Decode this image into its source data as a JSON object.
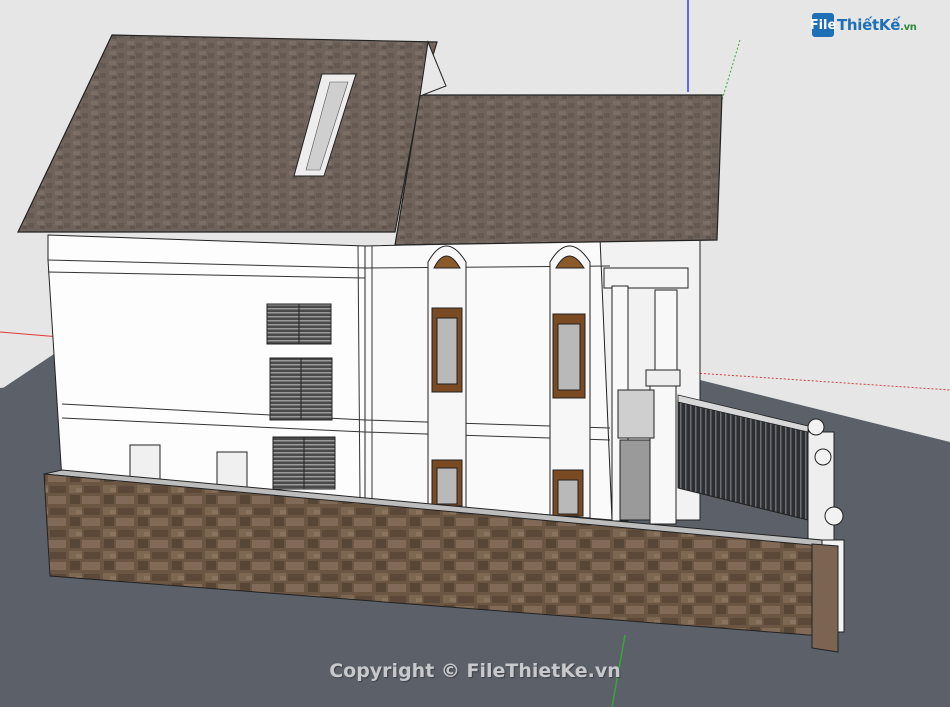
{
  "watermark": {
    "logo_mark": "File",
    "logo_text": "ThiếtKế",
    "logo_suffix": ".vn",
    "copyright": "Copyright © FileThietKe.vn"
  },
  "colors": {
    "sky": "#e6e6e6",
    "ground": "#5b6069",
    "roof": "#6e625a",
    "wall": "#ffffff",
    "stone": "#6b5543",
    "brand_blue": "#1e6fb5"
  },
  "icons": [
    "sketchup-axis-icon"
  ]
}
